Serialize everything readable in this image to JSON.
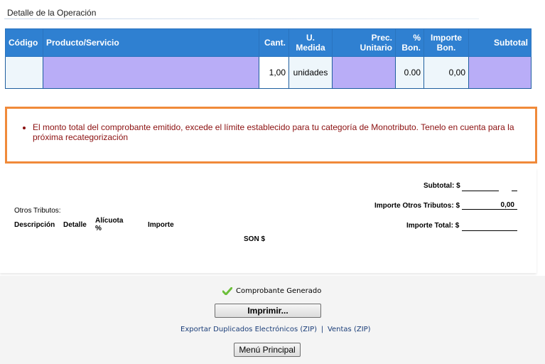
{
  "section": {
    "title": "Detalle de la Operación"
  },
  "detail_table": {
    "headers": {
      "codigo": "Código",
      "producto": "Producto/Servicio",
      "cant": "Cant.",
      "u_medida_1": "U.",
      "u_medida_2": "Medida",
      "prec_1": "Prec.",
      "prec_2": "Unitario",
      "bon_1": "%",
      "bon_2": "Bon.",
      "imp_bon_1": "Importe",
      "imp_bon_2": "Bon.",
      "subtotal": "Subtotal"
    },
    "rows": [
      {
        "cant": "1,00",
        "unidad": "unidades",
        "pct_bon": "0.00",
        "importe_bon": "0,00"
      }
    ]
  },
  "warning": {
    "message": "El monto total del comprobante emitido, excede el límite establecido para tu categoría de Monotributo. Tenelo en cuenta para la próxima recategorización"
  },
  "totals": {
    "subtotal_label": "Subtotal: $",
    "otros_tributos_label": "Importe Otros Tributos: $",
    "otros_tributos_value": "0,00",
    "total_label": "Importe Total: $",
    "otros_tributos_title": "Otros Tributos:",
    "col_descripcion": "Descripción",
    "col_detalle": "Detalle",
    "col_alicuota_1": "Alícuota",
    "col_alicuota_2": "%",
    "col_importe": "Importe",
    "son_label": "SON $"
  },
  "footer": {
    "status": "Comprobante Generado",
    "print_button": "Imprimir...",
    "export_link": "Exportar Duplicados Electrónicos (ZIP)",
    "separator": "|",
    "ventas_link": "Ventas (ZIP)",
    "menu_button": "Menú Principal"
  },
  "colors": {
    "header_blue": "#2f80d1",
    "warning_border": "#f08a3a",
    "warning_text": "#8b1010",
    "redacted": "#b9adf7",
    "check_green": "#6cbf3a"
  }
}
